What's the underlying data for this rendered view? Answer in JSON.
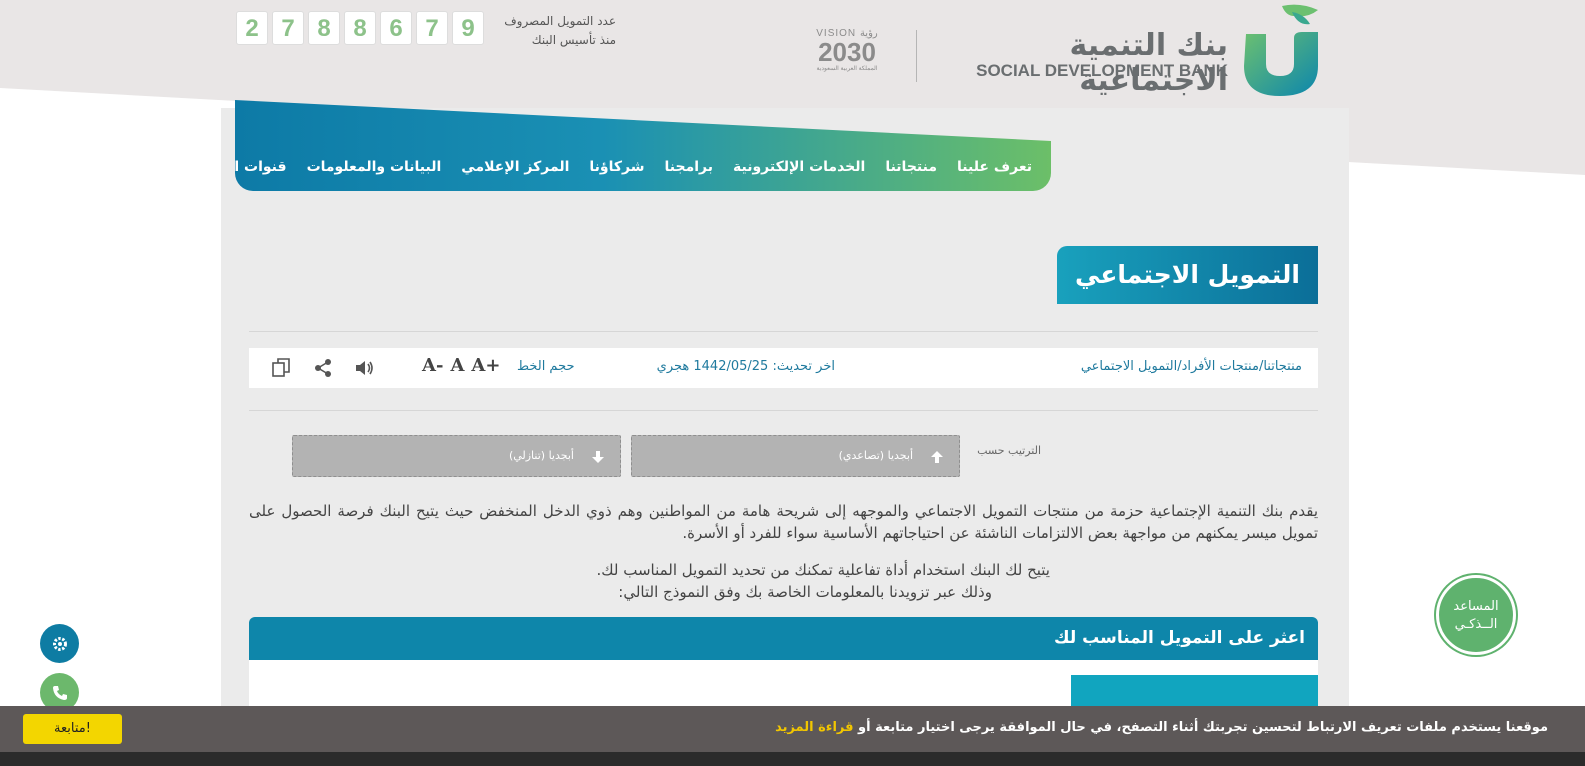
{
  "header": {
    "bank_name_ar": "بنك التنمية الاجتماعية",
    "bank_name_en": "SOCIAL DEVELOPMENT BANK",
    "vision_line1": "VISION رؤية",
    "vision_year": "2030",
    "vision_line3": "المملكة العربية السعودية",
    "counter_label_line1": "عدد التمويل المصروف",
    "counter_label_line2": "منذ تأسيس البنك",
    "counter_digits": [
      "2",
      "7",
      "8",
      "8",
      "6",
      "7",
      "9"
    ]
  },
  "nav": {
    "items": [
      "تعرف علينا",
      "منتجاتنا",
      "الخدمات الإلكترونية",
      "برامجنا",
      "شركاؤنا",
      "المركز الإعلامي",
      "البيانات والمعلومات",
      "قنوات التواصل"
    ]
  },
  "page": {
    "title": "التمويل الاجتماعي"
  },
  "toolbar": {
    "breadcrumb": "منتجاتنا/منتجات الأفراد/التمويل الاجتماعي",
    "updated": "اخر تحديث: 1442/05/25 هجري",
    "font_size_label": "حجم الخط",
    "font_increase": "A+",
    "font_normal": "A",
    "font_decrease": "A-"
  },
  "sort": {
    "label": "الترتيب حسب",
    "asc": "أبجديا (تصاعدي)",
    "desc": "أبجديا (تنازلي)"
  },
  "content": {
    "intro": "يقدم بنك التنمية الإجتماعية حزمة من منتجات التمويل الاجتماعي والموجهه إلى شريحة هامة من المواطنين وهم ذوي الدخل المنخفض حيث يتيح البنك فرصة الحصول على تمويل ميسر يمكنهم من مواجهة بعض الالتزامات الناشئة عن احتياجاتهم الأساسية سواء للفرد أو الأسرة.",
    "tool_line1": "يتيح لك البنك استخدام أداة تفاعلية تمكنك من تحديد التمويل المناسب لك.",
    "tool_line2": "وذلك عبر تزويدنا بالمعلومات الخاصة بك وفق النموذج التالي:",
    "finder_title": "اعثر على التمويل المناسب لك"
  },
  "assistant": {
    "line1": "المساعد",
    "line2": "الــذكـي"
  },
  "cookie": {
    "text": "موقعنا يستخدم ملفات تعريف الارتباط لتحسين تجربتك أثناء التصفح، في حال الموافقة يرجى اختيار متابعة أو",
    "more_link": "قراءة المزيد",
    "button": "متابعة!"
  },
  "colors": {
    "brand_teal": "#0e86aa",
    "brand_green": "#6cbf68",
    "accent_yellow": "#f3d600"
  }
}
